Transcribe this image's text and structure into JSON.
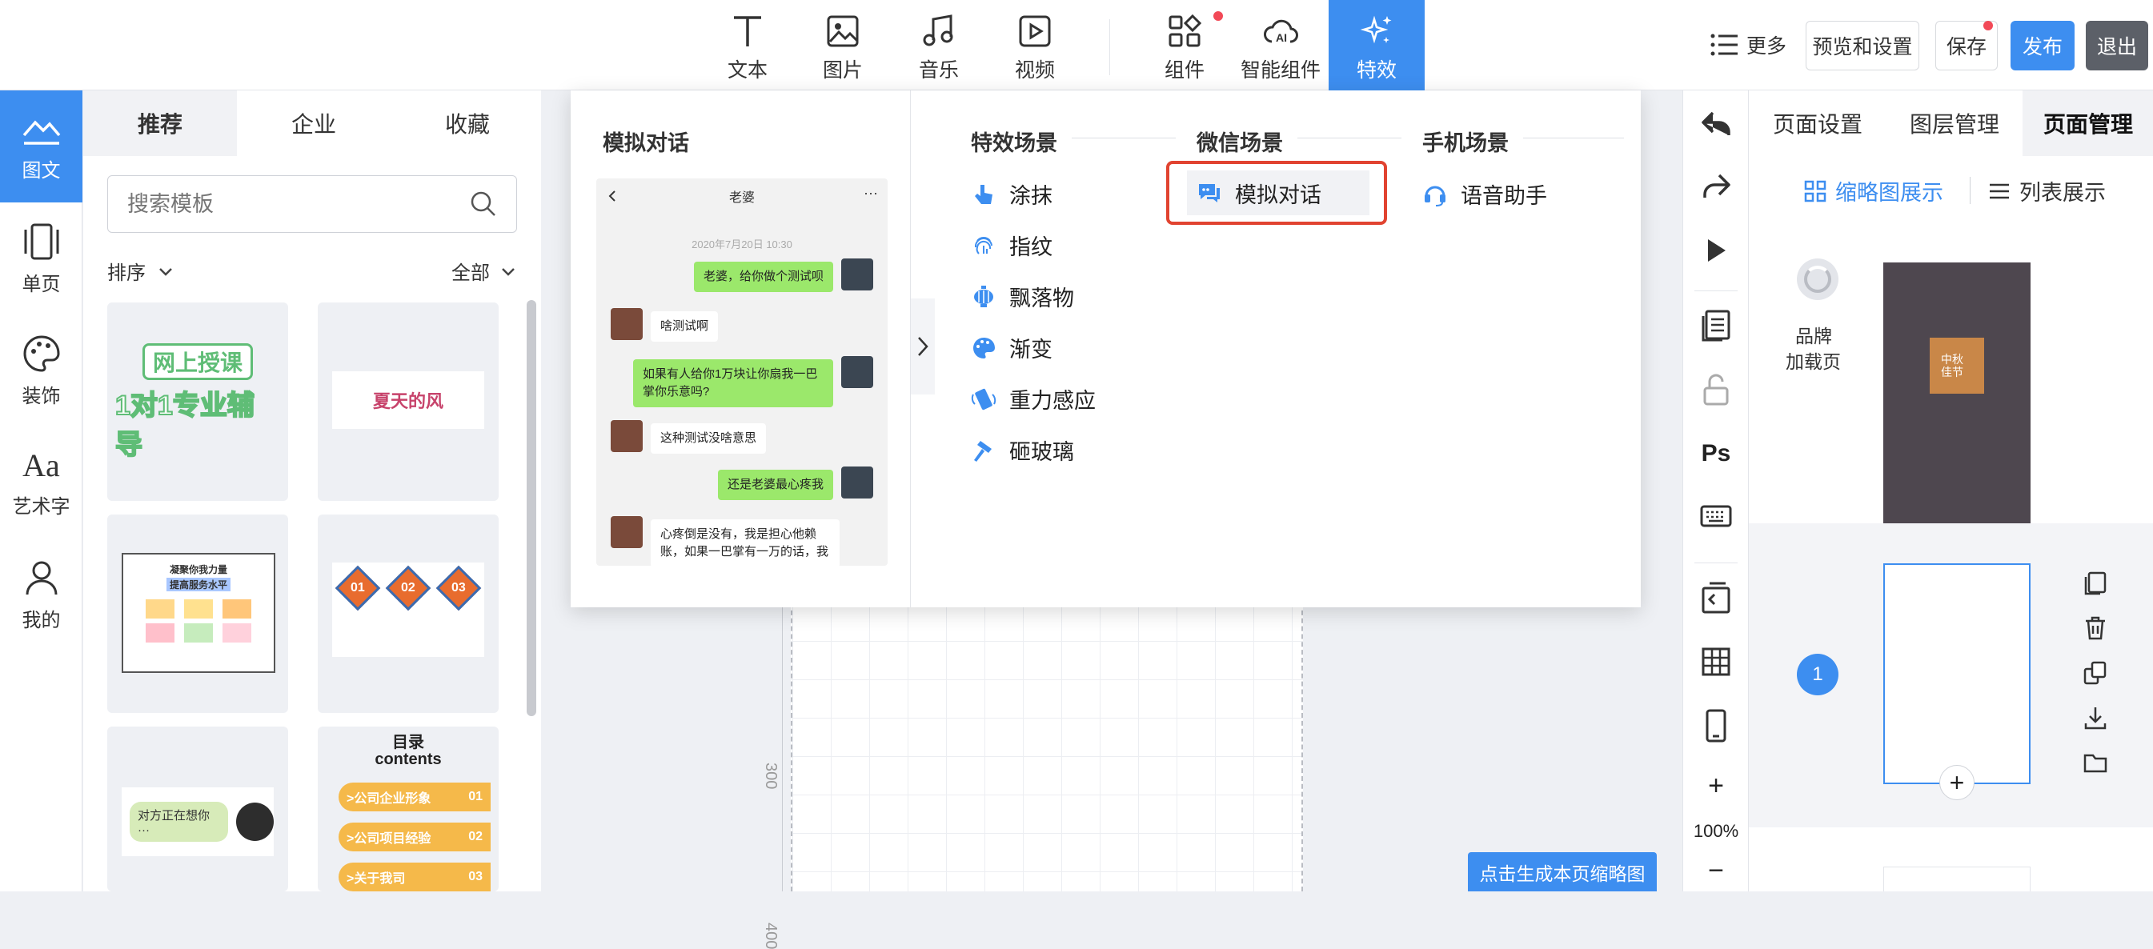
{
  "toolbar": {
    "tools": [
      {
        "label": "文本",
        "icon": "text-icon"
      },
      {
        "label": "图片",
        "icon": "image-icon"
      },
      {
        "label": "音乐",
        "icon": "music-icon"
      },
      {
        "label": "视频",
        "icon": "video-icon"
      },
      {
        "label": "组件",
        "icon": "components-icon"
      },
      {
        "label": "智能组件",
        "icon": "ai-cloud-icon"
      },
      {
        "label": "特效",
        "icon": "sparkle-icon"
      }
    ],
    "more_label": "更多",
    "preview_label": "预览和设置",
    "save_label": "保存",
    "publish_label": "发布",
    "exit_label": "退出",
    "accent_color": "#3d8ef0"
  },
  "rail": {
    "items": [
      {
        "label": "图文",
        "icon": "image-text-icon"
      },
      {
        "label": "单页",
        "icon": "single-page-icon"
      },
      {
        "label": "装饰",
        "icon": "palette-icon"
      },
      {
        "label": "艺术字",
        "icon": "art-text-icon"
      },
      {
        "label": "我的",
        "icon": "user-icon"
      }
    ]
  },
  "templates": {
    "tabs": [
      "推荐",
      "企业",
      "收藏"
    ],
    "search_placeholder": "搜索模板",
    "sort_label": "排序",
    "filter_label": "全部",
    "cards": [
      {
        "lines": [
          "网上授课",
          "1对1专业辅导"
        ]
      },
      {
        "lines": [
          "夏天的风"
        ]
      },
      {
        "lines": [
          "凝聚你我力量",
          "提高服务水平"
        ]
      },
      {
        "lines": [
          "01",
          "02",
          "03"
        ]
      },
      {
        "lines": [
          "对方正在想你···"
        ]
      },
      {
        "lines": [
          "目录",
          "contents",
          ">公司企业形象",
          ">公司项目经验",
          ">关于我司",
          "01",
          "02",
          "03"
        ]
      }
    ]
  },
  "dropdown": {
    "preview": {
      "title": "模拟对话",
      "chat_title": "老婆",
      "date": "2020年7月20日 10:30",
      "messages": [
        {
          "side": "me",
          "text": "老婆，给你做个测试呗"
        },
        {
          "side": "other",
          "text": "啥测试啊"
        },
        {
          "side": "me",
          "text": "如果有人给你1万块让你扇我一巴掌你乐意吗?"
        },
        {
          "side": "other",
          "text": "这种测试没啥意思"
        },
        {
          "side": "me",
          "text": "还是老婆最心疼我"
        },
        {
          "side": "other",
          "text": "心疼倒是没有，我是担心他赖账，如果一巴掌有一万的话，我"
        }
      ]
    },
    "columns": [
      {
        "title": "特效场景",
        "items": [
          {
            "label": "涂抹",
            "icon": "finger-icon"
          },
          {
            "label": "指纹",
            "icon": "fingerprint-icon"
          },
          {
            "label": "飘落物",
            "icon": "lantern-icon"
          },
          {
            "label": "渐变",
            "icon": "palette-icon"
          },
          {
            "label": "重力感应",
            "icon": "phone-tilt-icon"
          },
          {
            "label": "砸玻璃",
            "icon": "hammer-icon"
          }
        ]
      },
      {
        "title": "微信场景",
        "items": [
          {
            "label": "模拟对话",
            "icon": "chat-icon"
          }
        ]
      },
      {
        "title": "手机场景",
        "items": [
          {
            "label": "语音助手",
            "icon": "headset-icon"
          }
        ]
      }
    ]
  },
  "canvas": {
    "ruler_labels": [
      "300",
      "400"
    ],
    "thumbnail_button": "点击生成本页缩略图"
  },
  "sidetools": {
    "zoom_plus": "+",
    "zoom_level": "100%",
    "zoom_minus": "−",
    "ps_label": "Ps"
  },
  "rightpanel": {
    "tabs": [
      "页面设置",
      "图层管理",
      "页面管理"
    ],
    "view_thumbnail": "缩略图展示",
    "view_list": "列表展示",
    "brand_label_1": "品牌",
    "brand_label_2": "加载页",
    "page_number": "1",
    "brand_thumb_text": "中秋佳节",
    "add_page": "+"
  }
}
